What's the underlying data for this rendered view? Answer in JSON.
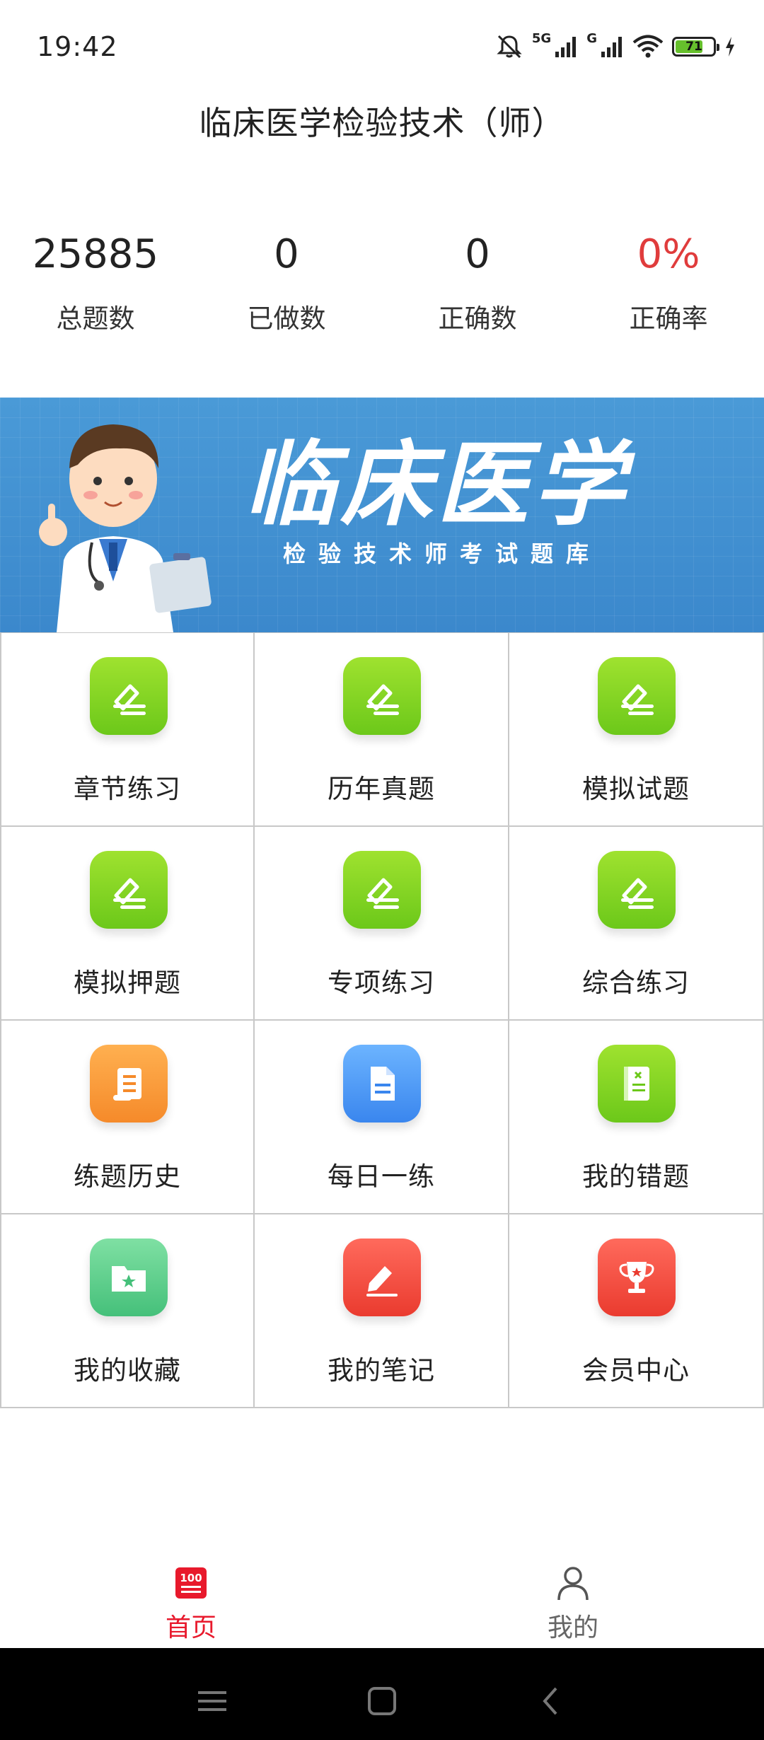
{
  "status_bar": {
    "time": "19:42",
    "network_5g": "5G",
    "network_g": "G",
    "battery_level": "71"
  },
  "page_title": "临床医学检验技术（师）",
  "stats": [
    {
      "value": "25885",
      "label": "总题数",
      "color": "#222222"
    },
    {
      "value": "0",
      "label": "已做数",
      "color": "#222222"
    },
    {
      "value": "0",
      "label": "正确数",
      "color": "#222222"
    },
    {
      "value": "0%",
      "label": "正确率",
      "color": "#e03c3c"
    }
  ],
  "banner": {
    "title": "临床医学",
    "subtitle": "检验技术师考试题库"
  },
  "menu": [
    {
      "label": "章节练习",
      "icon": "pencil-edit-icon",
      "color": "green"
    },
    {
      "label": "历年真题",
      "icon": "pencil-edit-icon",
      "color": "green"
    },
    {
      "label": "模拟试题",
      "icon": "pencil-edit-icon",
      "color": "green"
    },
    {
      "label": "模拟押题",
      "icon": "pencil-edit-icon",
      "color": "green"
    },
    {
      "label": "专项练习",
      "icon": "pencil-edit-icon",
      "color": "green"
    },
    {
      "label": "综合练习",
      "icon": "pencil-edit-icon",
      "color": "green"
    },
    {
      "label": "练题历史",
      "icon": "scroll-list-icon",
      "color": "orange"
    },
    {
      "label": "每日一练",
      "icon": "document-icon",
      "color": "blue"
    },
    {
      "label": "我的错题",
      "icon": "error-book-icon",
      "color": "green"
    },
    {
      "label": "我的收藏",
      "icon": "star-folder-icon",
      "color": "mint"
    },
    {
      "label": "我的笔记",
      "icon": "note-pencil-icon",
      "color": "red"
    },
    {
      "label": "会员中心",
      "icon": "trophy-icon",
      "color": "red"
    }
  ],
  "bottom_nav": {
    "home_label": "首页",
    "home_badge": "100",
    "mine_label": "我的"
  },
  "colors": {
    "accent_red": "#e8192c",
    "banner_blue": "#3b88cc"
  }
}
